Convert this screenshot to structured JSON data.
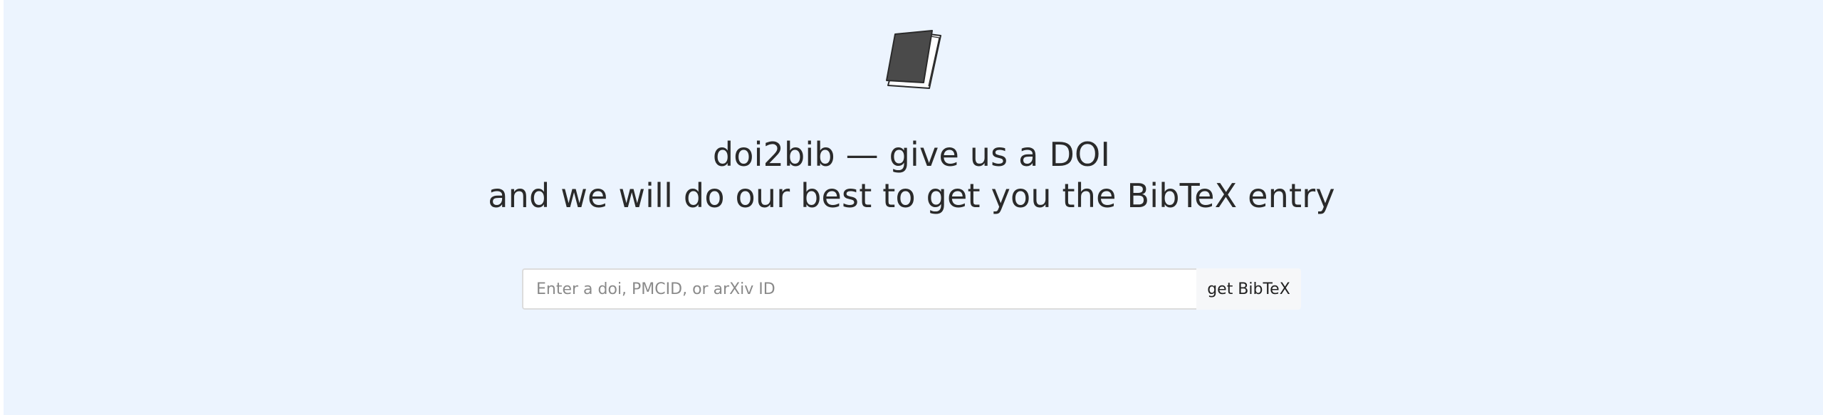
{
  "header": {
    "logo_icon": "closed-book-icon",
    "title_line1": "doi2bib — give us a DOI",
    "title_line2": "and we will do our best to get you the BibTeX entry"
  },
  "search": {
    "placeholder": "Enter a doi, PMCID, or arXiv ID",
    "value": "",
    "button_label": "get BibTeX"
  },
  "colors": {
    "background": "#ecf4fe",
    "text": "#2a2a2a",
    "book": "#4a4a4a"
  }
}
